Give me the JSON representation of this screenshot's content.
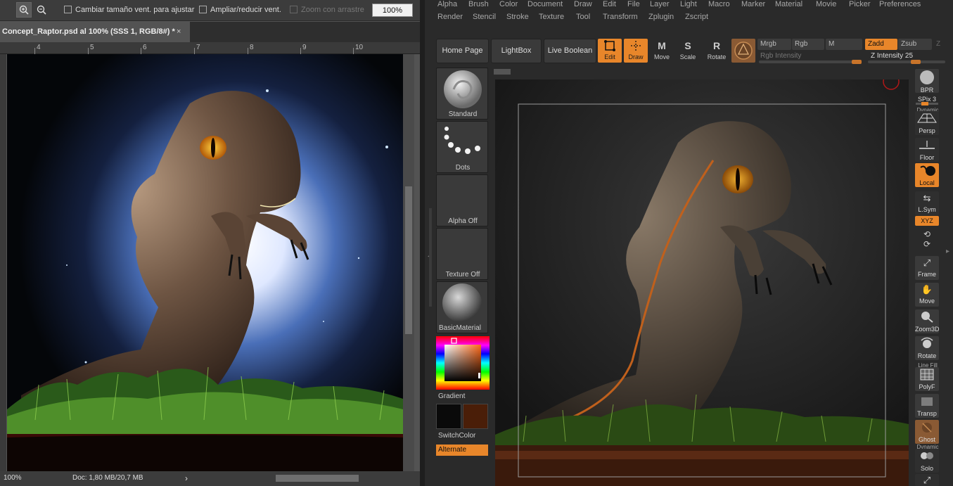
{
  "photoshop": {
    "options": {
      "zoom_in_icon": "zoom-in-icon",
      "zoom_out_icon": "zoom-out-icon",
      "resize_label": "Cambiar tamaño vent. para ajustar",
      "zoom_all_label": "Ampliar/reducir vent.",
      "scrubby_label": "Zoom con arrastre",
      "zoom_value": "100%"
    },
    "tab": {
      "title": "Concept_Raptor.psd al 100% (SSS 1, RGB/8#) *",
      "close": "×"
    },
    "ruler_numbers": [
      "4",
      "5",
      "6",
      "7",
      "8",
      "9",
      "10"
    ],
    "status": {
      "zoom": "100%",
      "doc": "Doc: 1,80 MB/20,7 MB",
      "arrow": "›"
    }
  },
  "zbrush": {
    "menu": [
      "Alpha",
      "Brush",
      "Color",
      "Document",
      "Draw",
      "Edit",
      "File",
      "Layer",
      "Light",
      "Macro",
      "Marker",
      "Material",
      "Movie",
      "Picker",
      "Preferences",
      "Render",
      "Stencil",
      "Stroke",
      "Texture",
      "Tool",
      "Transform",
      "Zplugin",
      "Zscript"
    ],
    "shelf": {
      "home_page": "Home Page",
      "lightbox": "LightBox",
      "live_boolean": "Live Boolean",
      "edit": "Edit",
      "draw": "Draw",
      "move": "Move",
      "scale": "Scale",
      "rotate": "Rotate",
      "move_glyph": "M",
      "scale_glyph": "S",
      "rotate_glyph": "R",
      "mrgb": "Mrgb",
      "rgb": "Rgb",
      "m": "M",
      "zadd": "Zadd",
      "zsub": "Zsub",
      "z": "Z",
      "rgb_intensity": "Rgb Intensity",
      "z_intensity": "Z Intensity 25",
      "z_intensity_level": 25
    },
    "left_tray": {
      "standard": "Standard",
      "dots": "Dots",
      "alpha_off": "Alpha Off",
      "texture_off": "Texture Off",
      "basic_material": "BasicMaterial",
      "gradient": "Gradient",
      "switch_color": "SwitchColor",
      "alternate": "Alternate",
      "main_color": "#0a0a0a",
      "secondary_color": "#4a1e08"
    },
    "right_tray": {
      "bpr": "BPR",
      "spix": "SPix 3",
      "dynamic": "Dynamic",
      "persp": "Persp",
      "floor": "Floor",
      "local": "Local",
      "lsym": "L.Sym",
      "xyz": "XYZ",
      "frame": "Frame",
      "move": "Move",
      "zoom3d": "Zoom3D",
      "rotate": "Rotate",
      "line_fill": "Line Fill",
      "polyf": "PolyF",
      "transp": "Transp",
      "ghost": "Ghost",
      "dynamic2": "Dynamic",
      "solo": "Solo"
    },
    "accent_color": "#e8862a"
  }
}
